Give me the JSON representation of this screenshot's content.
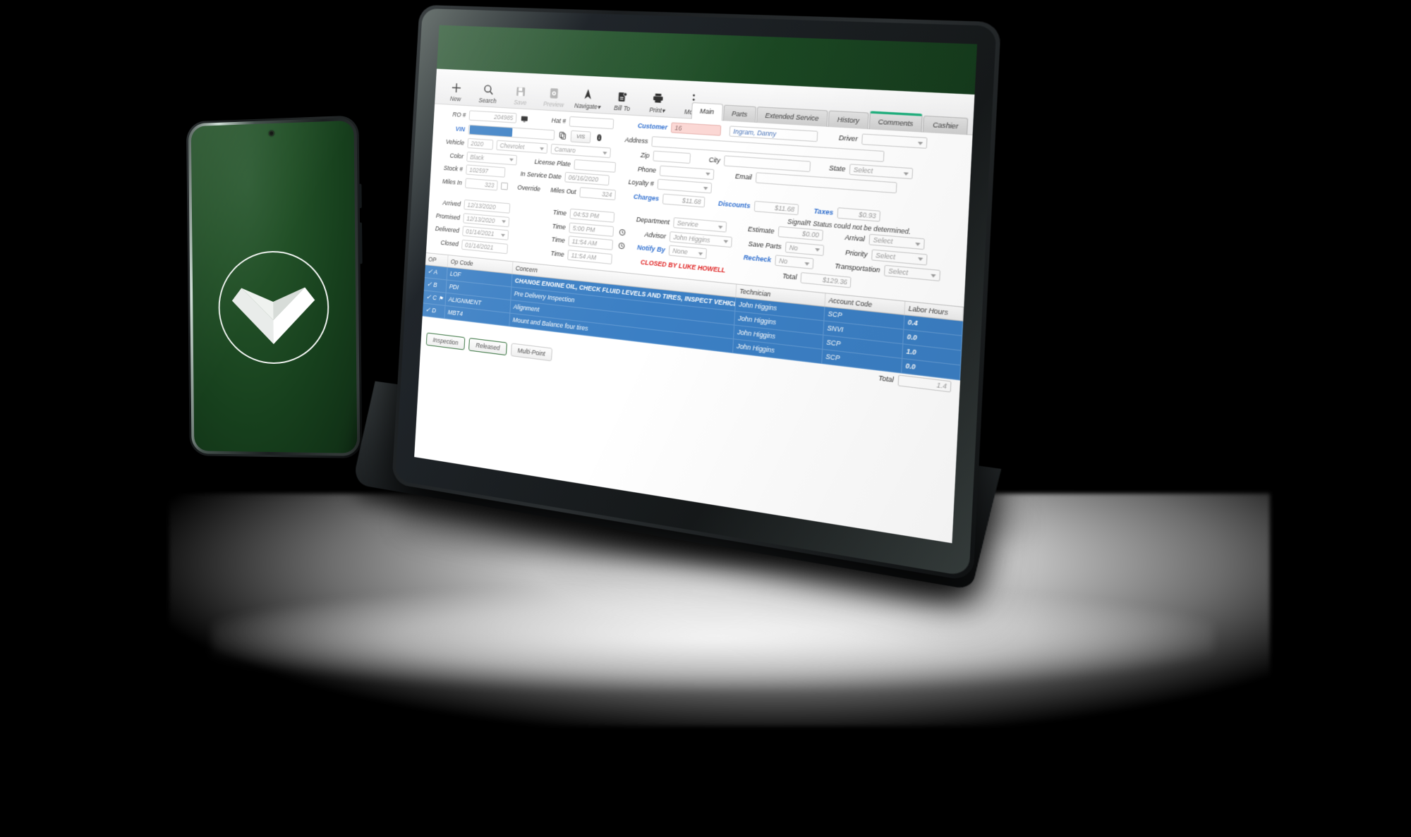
{
  "scene": {
    "background_color": "#000000",
    "devices": [
      "phone",
      "tablet"
    ]
  },
  "phone": {
    "screen_bg_color": "#1d4a25",
    "logo_name": "v-chevron-logo",
    "logo_color": "#ffffff",
    "camera_name": "front-camera"
  },
  "tablet": {
    "app": {
      "header_color": "#1d4a25",
      "toolbar": [
        {
          "label": "New",
          "icon": "plus-icon",
          "enabled": true,
          "caret": false
        },
        {
          "label": "Search",
          "icon": "search-icon",
          "enabled": true,
          "caret": false
        },
        {
          "label": "Save",
          "icon": "save-icon",
          "enabled": false,
          "caret": false
        },
        {
          "label": "Preview",
          "icon": "preview-icon",
          "enabled": false,
          "caret": false
        },
        {
          "label": "Navigate",
          "icon": "navigate-icon",
          "enabled": true,
          "caret": true
        },
        {
          "label": "Bill To",
          "icon": "bill-to-icon",
          "enabled": true,
          "caret": false
        },
        {
          "label": "Print",
          "icon": "printer-icon",
          "enabled": true,
          "caret": true
        },
        {
          "label": "More",
          "icon": "kebab-menu-icon",
          "enabled": true,
          "caret": true
        }
      ],
      "tabs": [
        {
          "label": "Main",
          "active": true,
          "accent": false
        },
        {
          "label": "Parts",
          "active": false,
          "accent": false
        },
        {
          "label": "Extended Service",
          "active": false,
          "accent": false
        },
        {
          "label": "History",
          "active": false,
          "accent": false
        },
        {
          "label": "Comments",
          "active": false,
          "accent": true
        },
        {
          "label": "Cashier",
          "active": false,
          "accent": false
        }
      ],
      "labels": {
        "ro": "RO #",
        "hat": "Hat #",
        "customer": "Customer",
        "driver": "Driver",
        "vin": "VIN",
        "vis": "VIS",
        "address": "Address",
        "vehicle": "Vehicle",
        "zip": "Zip",
        "city": "City",
        "state": "State",
        "color": "Color",
        "license_plate": "License Plate",
        "phone": "Phone",
        "email": "Email",
        "stock": "Stock #",
        "in_service_date": "In Service Date",
        "loyalty": "Loyalty #",
        "miles_in": "Miles In",
        "override": "Override",
        "miles_out": "Miles Out",
        "charges": "Charges",
        "discounts": "Discounts",
        "taxes": "Taxes",
        "arrived": "Arrived",
        "time": "Time",
        "department": "Department",
        "estimate": "Estimate",
        "arrival": "Arrival",
        "promised": "Promised",
        "advisor": "Advisor",
        "save_parts": "Save Parts",
        "priority": "Priority",
        "delivered": "Delivered",
        "notify_by": "Notify By",
        "recheck": "Recheck",
        "transportation": "Transportation",
        "closed": "Closed",
        "total": "Total"
      },
      "values": {
        "ro": "204985",
        "hat": "",
        "customer_id": "16",
        "customer_name": "Ingram, Danny",
        "driver": "",
        "vin": "",
        "vis": "VIS",
        "address": "",
        "vehicle_year": "2020",
        "vehicle_make": "Chevrolet",
        "vehicle_model": "Camaro",
        "zip": "",
        "city": "",
        "state": "Select",
        "color": "Black",
        "license_plate": "",
        "phone": "",
        "email": "",
        "stock": "102597",
        "in_service_date": "06/16/2020",
        "loyalty": "",
        "miles_in": "323",
        "miles_out": "324",
        "charges": "$11.68",
        "discounts": "$11.68",
        "taxes": "$0.93",
        "arrived_date": "12/13/2020",
        "arrived_time": "04:53 PM",
        "department": "Service",
        "estimate": "$0.00",
        "arrival": "Select",
        "promised_date": "12/13/2020",
        "promised_time": "5:00 PM",
        "advisor": "John Higgins",
        "save_parts": "No",
        "priority": "Select",
        "delivered_date": "01/14/2021",
        "delivered_time": "11:54 AM",
        "notify_by": "None",
        "recheck": "No",
        "transportation": "Select",
        "closed_date": "01/14/2021",
        "closed_time": "11:54 AM",
        "total": "$129.36"
      },
      "messages": {
        "signalr": "SignalR Status could not be determined.",
        "closed_by": "CLOSED BY LUKE HOWELL",
        "closed_by_color": "#e02424"
      },
      "grid": {
        "columns": [
          "OP",
          "Op Code",
          "Concern",
          "Technician",
          "Account Code",
          "Labor Hours"
        ],
        "rows": [
          {
            "checked": true,
            "op": "A",
            "flag": false,
            "op_code": "LOF",
            "concern": "CHANGE ENGINE OIL, CHECK FLUID LEVELS AND TIRES, INSPECT VEHICLE",
            "technician": "John Higgins",
            "account_code": "SCP",
            "labor_hours": "0.4"
          },
          {
            "checked": true,
            "op": "B",
            "flag": false,
            "op_code": "PDI",
            "concern": "Pre Delivery Inspection",
            "technician": "John Higgins",
            "account_code": "SNVI",
            "labor_hours": "0.0"
          },
          {
            "checked": true,
            "op": "C",
            "flag": true,
            "op_code": "ALIGNMENT",
            "concern": "Alignment",
            "technician": "John Higgins",
            "account_code": "SCP",
            "labor_hours": "1.0"
          },
          {
            "checked": true,
            "op": "D",
            "flag": false,
            "op_code": "MBT4",
            "concern": "Mount and Balance four tires",
            "technician": "John Higgins",
            "account_code": "SCP",
            "labor_hours": "0.0"
          }
        ],
        "row_color": "#3b7fc4",
        "labor_total_label": "Total",
        "labor_total": "1.4"
      },
      "buttons": [
        {
          "label": "Inspection",
          "outlined": true
        },
        {
          "label": "Released",
          "outlined": true
        },
        {
          "label": "Multi-Point",
          "outlined": false
        }
      ]
    }
  }
}
